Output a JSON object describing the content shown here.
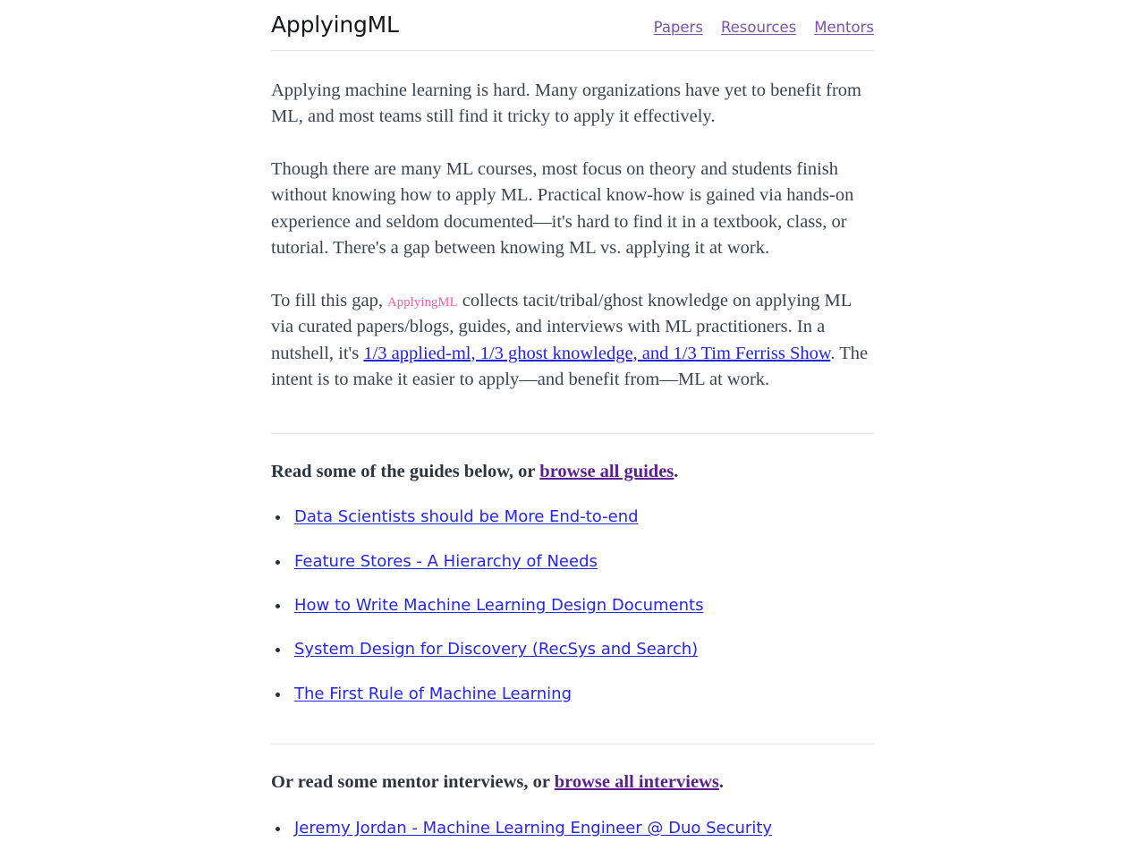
{
  "header": {
    "logo": "ApplyingML",
    "nav": [
      {
        "label": "Papers"
      },
      {
        "label": "Resources"
      },
      {
        "label": "Mentors"
      }
    ]
  },
  "intro": {
    "paragraph_1": "Applying machine learning is hard. Many organizations have yet to benefit from ML, and most teams still find it tricky to apply it effectively.",
    "paragraph_2": "Though there are many ML courses, most focus on theory and students finish without knowing how to apply ML. Practical know-how is gained via hands-on experience and seldom documented—it's hard to find it in a textbook, class, or tutorial. There's a gap between knowing ML vs. applying it at work.",
    "paragraph_3": {
      "before_brand": "To fill this gap,",
      "brand": "ApplyingML",
      "after_brand": "collects tacit/tribal/ghost knowledge on applying ML via curated papers/blogs, guides, and interviews with ML practitioners. In a nutshell, it's",
      "link": "1/3 applied-ml, 1/3 ghost knowledge, and 1/3 Tim Ferriss Show",
      "after_link": ". The intent is to make it easier to apply—and benefit from—ML at work."
    }
  },
  "guides": {
    "intro_before_link": "Read some of the guides below, or",
    "intro_link": "browse all guides",
    "intro_after_link": ".",
    "items": [
      {
        "label": "Data Scientists should be More End-to-end"
      },
      {
        "label": "Feature Stores - A Hierarchy of Needs"
      },
      {
        "label": "How to Write Machine Learning Design Documents"
      },
      {
        "label": "System Design for Discovery (RecSys and Search)"
      },
      {
        "label": "The First Rule of Machine Learning"
      }
    ]
  },
  "mentors": {
    "intro_before_link": "Or read some mentor interviews, or",
    "intro_link": "browse all interviews",
    "intro_after_link": ".",
    "items": [
      {
        "label": "Jeremy Jordan - Machine Learning Engineer @ Duo Security"
      }
    ]
  },
  "colors": {
    "nav_link": "#7b52ab",
    "brand_pink": "#f25c9e",
    "link_blue": "#2323dd",
    "visited_purple": "#5a1e95",
    "body_text": "#3d4450",
    "rule": "#e2e2e2"
  }
}
